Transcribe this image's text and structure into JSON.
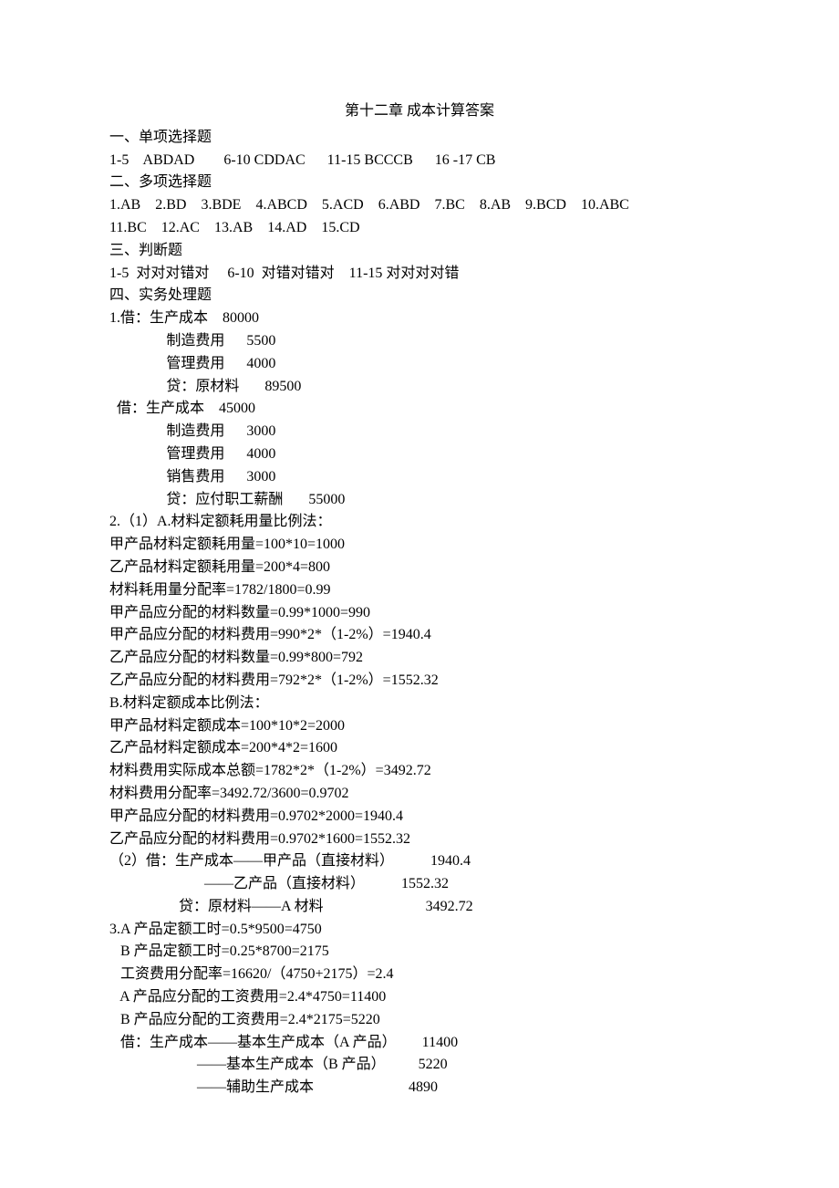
{
  "title": "第十二章    成本计算答案",
  "s1_h": "一、单项选择题",
  "s1_l1": "1-5    ABDAD        6-10 CDDAC      11-15 BCCCB      16 -17 CB",
  "s2_h": "二、多项选择题",
  "s2_l1": "1.AB    2.BD    3.BDE    4.ABCD    5.ACD    6.ABD    7.BC    8.AB    9.BCD    10.ABC",
  "s2_l2": "11.BC    12.AC    13.AB    14.AD    15.CD",
  "s3_h": "三、判断题",
  "s3_l1": "1-5  对对对错对     6-10  对错对错对    11-15 对对对对错",
  "s4_h": "四、实务处理题",
  "q1_l1": "1.借：生产成本    80000",
  "q1_l2": "制造费用      5500",
  "q1_l3": "管理费用      4000",
  "q1_l4": "贷：原材料       89500",
  "q1_l5": "  借：生产成本    45000",
  "q1_l6": "制造费用      3000",
  "q1_l7": "管理费用      4000",
  "q1_l8": "销售费用      3000",
  "q1_l9": "贷：应付职工薪酬       55000",
  "q2_l1": "2.（1）A.材料定额耗用量比例法：",
  "q2_l2": "甲产品材料定额耗用量=100*10=1000",
  "q2_l3": "乙产品材料定额耗用量=200*4=800",
  "q2_l4": "材料耗用量分配率=1782/1800=0.99",
  "q2_l5": "甲产品应分配的材料数量=0.99*1000=990",
  "q2_l6": "甲产品应分配的材料费用=990*2*（1-2%）=1940.4",
  "q2_l7": "乙产品应分配的材料数量=0.99*800=792",
  "q2_l8": "乙产品应分配的材料费用=792*2*（1-2%）=1552.32",
  "q2_l9": "B.材料定额成本比例法：",
  "q2_l10": "甲产品材料定额成本=100*10*2=2000",
  "q2_l11": "乙产品材料定额成本=200*4*2=1600",
  "q2_l12": "材料费用实际成本总额=1782*2*（1-2%）=3492.72",
  "q2_l13": "材料费用分配率=3492.72/3600=0.9702",
  "q2_l14": "甲产品应分配的材料费用=0.9702*2000=1940.4",
  "q2_l15": "乙产品应分配的材料费用=0.9702*1600=1552.32",
  "q2_l16": "（2）借：生产成本——甲产品（直接材料）          1940.4",
  "q2_l17": "                          ——乙产品（直接材料）          1552.32",
  "q2_l18": "                   贷：原材料——A 材料                            3492.72",
  "q3_l1": "3.A 产品定额工时=0.5*9500=4750",
  "q3_l2": "   B 产品定额工时=0.25*8700=2175",
  "q3_l3": "   工资费用分配率=16620/（4750+2175）=2.4",
  "q3_l4": "   A 产品应分配的工资费用=2.4*4750=11400",
  "q3_l5": "   B 产品应分配的工资费用=2.4*2175=5220",
  "q3_l6": "   借：生产成本——基本生产成本（A 产品）       11400",
  "q3_l7": "                        ——基本生产成本（B 产品）         5220",
  "q3_l8": "                        ——辅助生产成本                          4890"
}
